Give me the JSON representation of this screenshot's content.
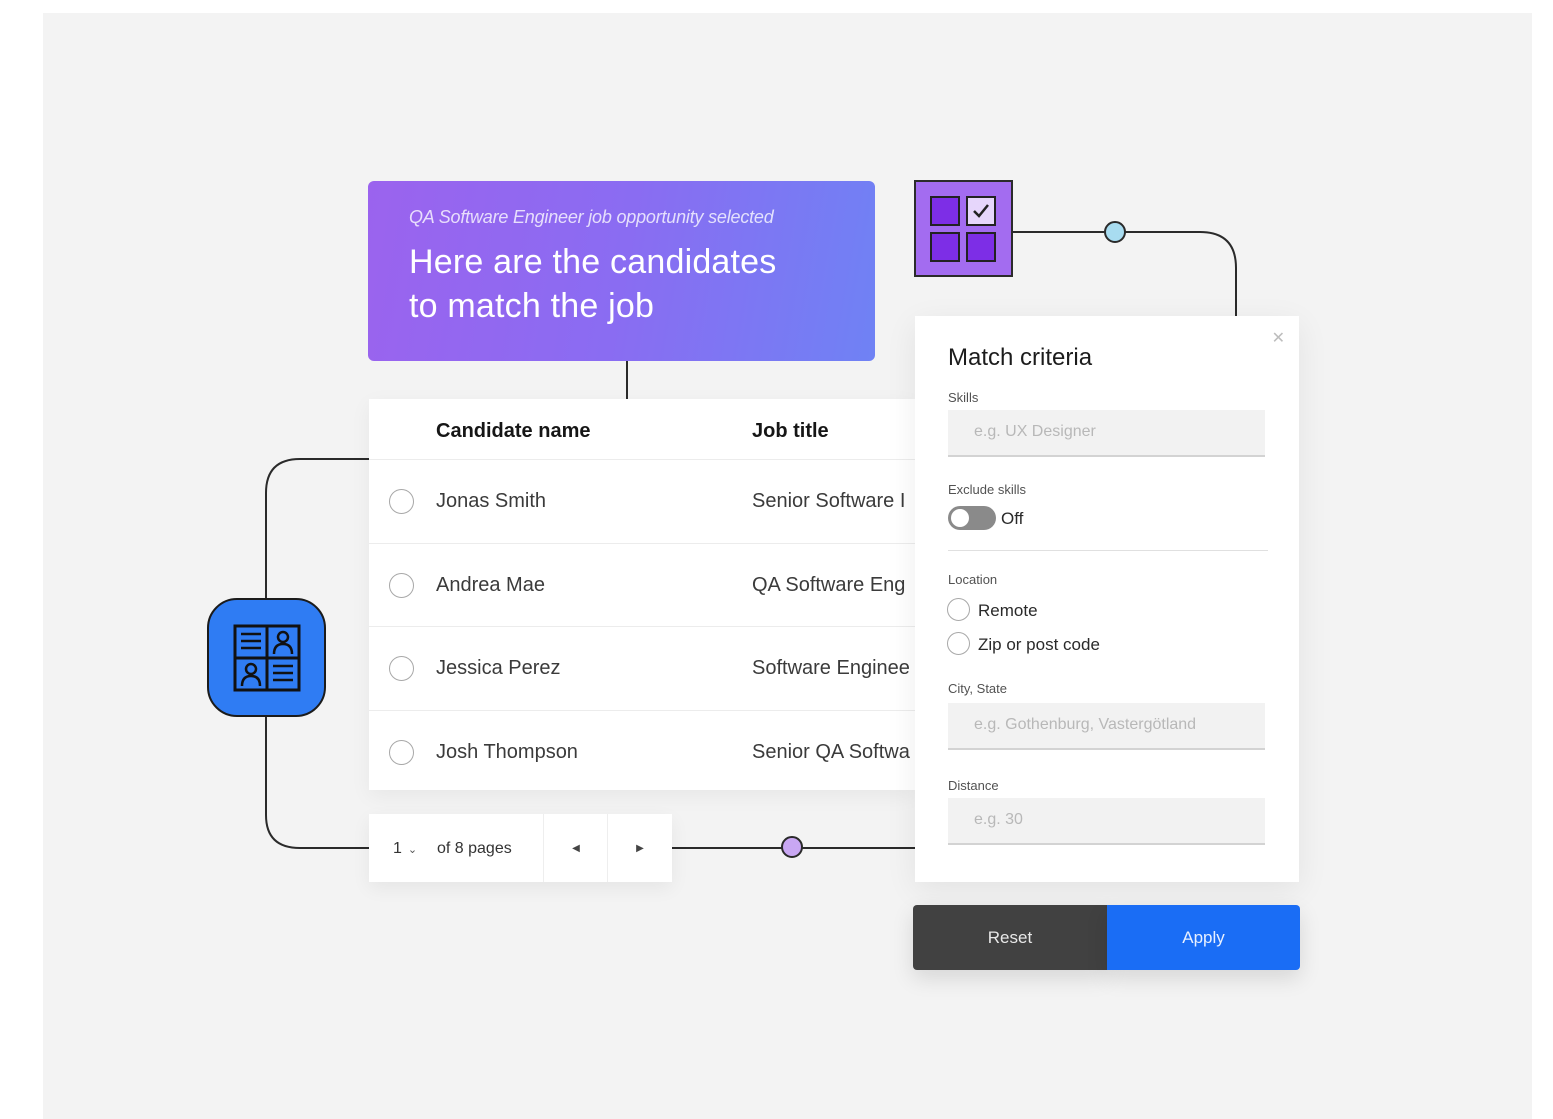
{
  "banner": {
    "subtitle": "QA Software Engineer job opportunity selected",
    "title_line1": "Here are the candidates",
    "title_line2": "to match the job"
  },
  "table": {
    "columns": [
      "Candidate name",
      "Job title"
    ],
    "rows": [
      {
        "name": "Jonas Smith",
        "job": "Senior Software I"
      },
      {
        "name": "Andrea Mae",
        "job": "QA Software Eng"
      },
      {
        "name": "Jessica Perez",
        "job": "Software Enginee"
      },
      {
        "name": "Josh Thompson",
        "job": "Senior QA Softwa"
      }
    ]
  },
  "pagination": {
    "current_page": "1",
    "of_pages": "of 8 pages",
    "prev_icon": "caret-left-icon",
    "next_icon": "caret-right-icon"
  },
  "criteria": {
    "heading": "Match criteria",
    "close_icon": "close-icon",
    "skills_label": "Skills",
    "skills_placeholder": "e.g. UX Designer",
    "exclude_label": "Exclude skills",
    "exclude_state": "Off",
    "location_label": "Location",
    "location_options": [
      "Remote",
      "Zip or post code"
    ],
    "city_label": "City, State",
    "city_placeholder": "e.g. Gothenburg, Vastergötland",
    "distance_label": "Distance",
    "distance_placeholder": "e.g. 30"
  },
  "actions": {
    "reset": "Reset",
    "apply": "Apply"
  },
  "icons": {
    "profiles_tile": "candidate-profiles-icon",
    "grid_tile": "checklist-grid-icon"
  },
  "colors": {
    "background": "#f3f3f3",
    "banner_start": "#9b63ee",
    "banner_end": "#6f82f4",
    "profiles_tile": "#2f7cf3",
    "grid_tile": "#a36cf0",
    "apply": "#1a6df5",
    "reset": "#414141",
    "node_blue": "#a8dcf0",
    "node_purple": "#c9a7f3"
  }
}
